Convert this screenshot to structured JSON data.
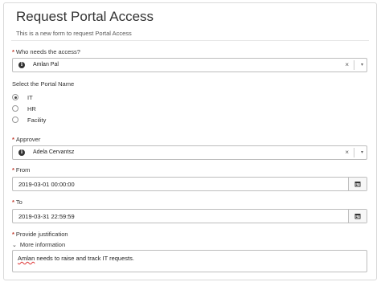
{
  "form": {
    "title": "Request Portal Access",
    "subtitle": "This is a new form to request Portal Access"
  },
  "who": {
    "required_mark": "*",
    "label": "Who needs the access?",
    "value": "Amlan Pal",
    "clear": "×",
    "caret": "▾"
  },
  "portal": {
    "label": "Select the Portal Name",
    "options": [
      {
        "label": "IT",
        "checked": true
      },
      {
        "label": "HR",
        "checked": false
      },
      {
        "label": "Facility",
        "checked": false
      }
    ]
  },
  "approver": {
    "required_mark": "*",
    "label": "Approver",
    "value": "Adela Cervantsz",
    "clear": "×",
    "caret": "▾"
  },
  "from": {
    "required_mark": "*",
    "label": "From",
    "value": "2019-03-01 00:00:00"
  },
  "to": {
    "required_mark": "*",
    "label": "To",
    "value": "2019-03-31 22:59:59"
  },
  "justification": {
    "required_mark": "*",
    "label": "Provide justification",
    "more_info": "More information",
    "value_word1": "Amlan",
    "value_rest": " needs to raise and track IT requests."
  },
  "icons": {
    "info": "info-icon",
    "calendar": "calendar-icon",
    "chevron": "chevron-down-icon"
  }
}
